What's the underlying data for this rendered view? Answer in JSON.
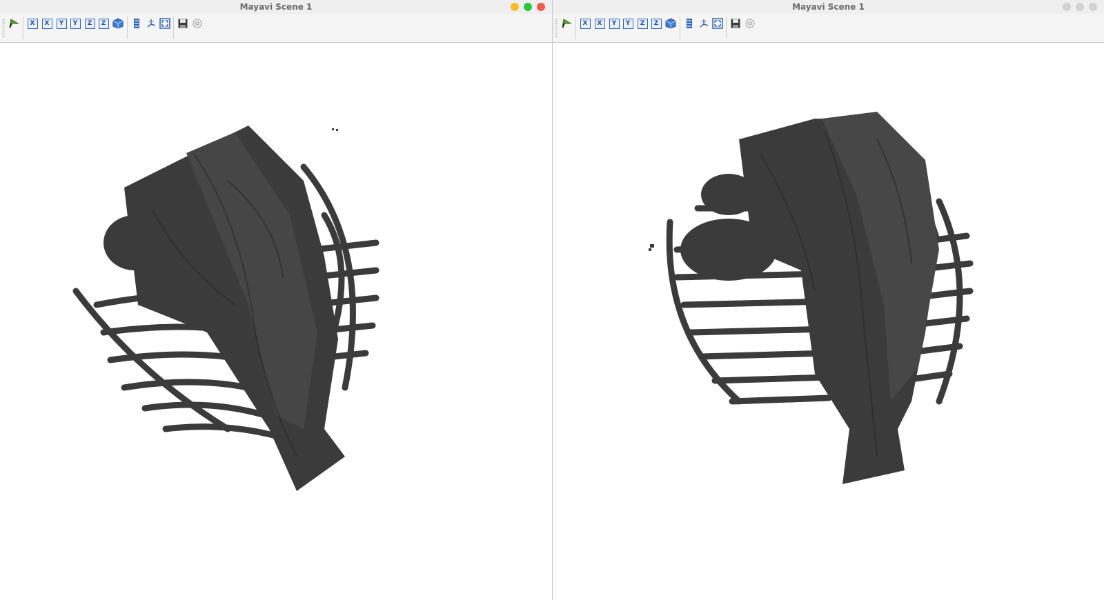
{
  "windows": [
    {
      "title": "Mayavi Scene 1",
      "active": true,
      "traffic_lights": [
        "#f6be2f",
        "#28c840",
        "#ec5b4d"
      ]
    },
    {
      "title": "Mayavi Scene 1",
      "active": false,
      "traffic_lights": [
        "#d2d2d2",
        "#d2d2d2",
        "#d2d2d2"
      ]
    }
  ],
  "toolbar": {
    "buttons": [
      {
        "name": "pipeline-icon",
        "glyph": ""
      },
      {
        "name": "view-x-plus-icon",
        "glyph": "X"
      },
      {
        "name": "view-x-minus-icon",
        "glyph": "X"
      },
      {
        "name": "view-y-plus-icon",
        "glyph": "Y"
      },
      {
        "name": "view-y-minus-icon",
        "glyph": "Y"
      },
      {
        "name": "view-z-plus-icon",
        "glyph": "Z"
      },
      {
        "name": "view-z-minus-icon",
        "glyph": "Z"
      },
      {
        "name": "isometric-view-icon",
        "glyph": ""
      },
      {
        "name": "parallel-projection-icon",
        "glyph": ""
      },
      {
        "name": "axes-indicator-icon",
        "glyph": ""
      },
      {
        "name": "full-screen-icon",
        "glyph": ""
      },
      {
        "name": "save-icon",
        "glyph": ""
      },
      {
        "name": "configure-icon",
        "glyph": ""
      }
    ]
  },
  "scene": {
    "background": "#ffffff",
    "surface_color": "#3b3b3b"
  }
}
